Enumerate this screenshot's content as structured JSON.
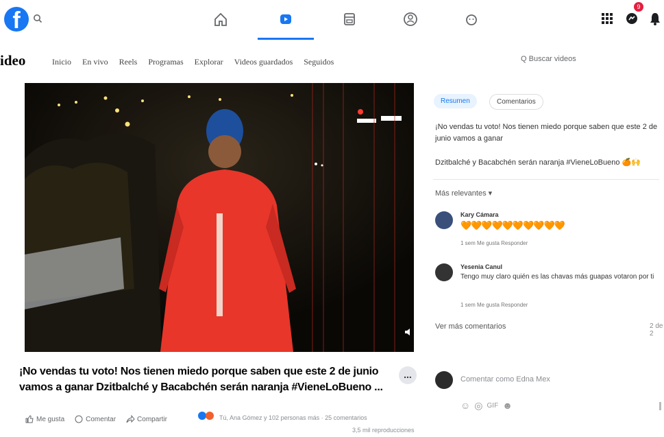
{
  "topbar": {
    "logo_letter": "f",
    "notification_count": "9"
  },
  "subnav": {
    "title": "ideo",
    "tabs": [
      "Inicio",
      "En vivo",
      "Reels",
      "Programas",
      "Explorar",
      "Videos guardados",
      "Seguidos"
    ],
    "search_label": "Q Buscar videos"
  },
  "post": {
    "caption": "¡No vendas tu voto! Nos tienen miedo porque saben que este 2 de junio vamos a ganar Dzitbalché y Bacabchén serán naranja #VieneLoBueno ...",
    "more_label": "...",
    "actions": [
      "Me gusta",
      "Comentar",
      "Compartir"
    ],
    "reactions_summary": "Tú, Ana Gómez y 102 personas más · 25 comentarios",
    "views": "3,5 mil reproducciones"
  },
  "panel": {
    "tabs": [
      "Resumen",
      "Comentarios"
    ],
    "description": "¡No vendas tu voto! Nos tienen miedo porque saben que este 2 de junio vamos a ganar",
    "description2": "Dzitbalché y Bacabchén serán naranja #VieneLoBueno 🍊🙌",
    "relevant_label": "Más relevantes ▾",
    "comments": [
      {
        "name": "Kary Cámara",
        "text": "🧡🧡🧡🧡🧡🧡🧡🧡🧡🧡",
        "meta": "1 sem   Me gusta   Responder"
      },
      {
        "name": "Yesenia Canul",
        "text": "Tengo muy claro quién es las chavas más guapas votaron por ti",
        "meta": "1 sem   Me gusta   Responder"
      }
    ],
    "more_comments": "Ver más comentarios",
    "comments_count": "2 de 2",
    "composer_placeholder": "Comentar como Edna Mex",
    "composer_icons": [
      "☺",
      "◎",
      "GIF",
      "☻"
    ]
  },
  "colors": {
    "brand": "#1877f2",
    "badge": "#e41e3f",
    "shirt": "#e8362a"
  }
}
